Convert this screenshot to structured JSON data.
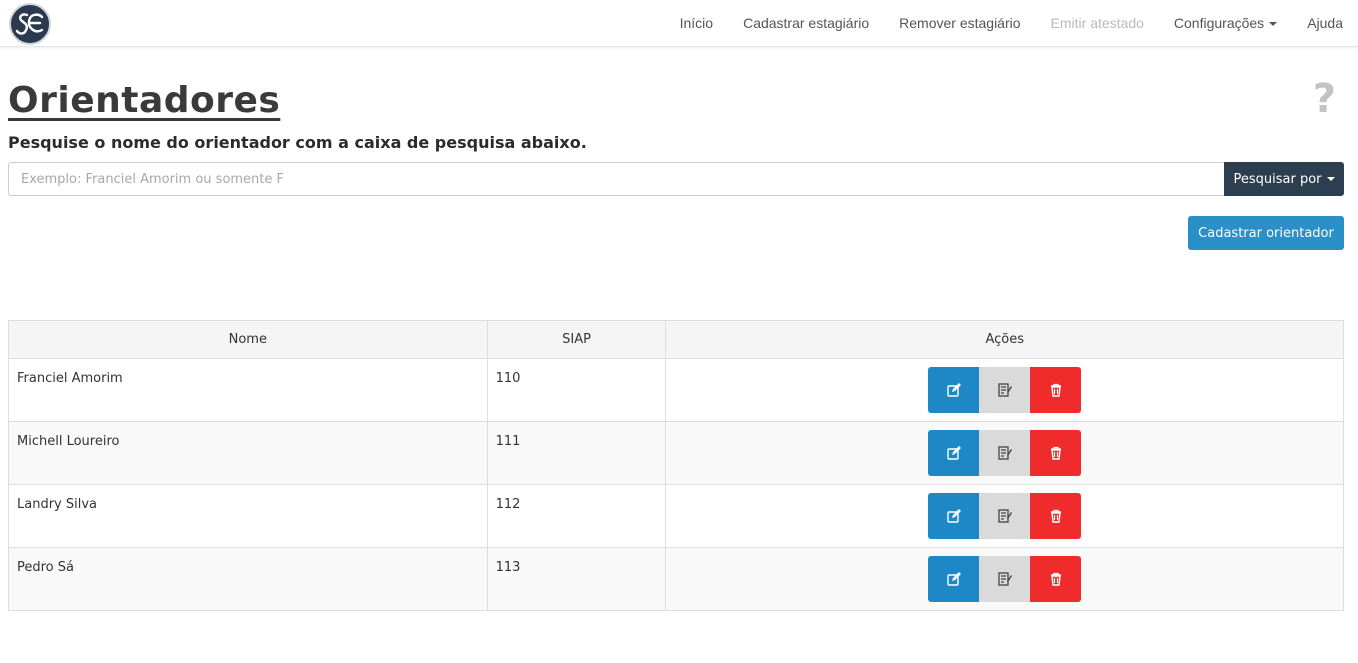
{
  "navbar": {
    "brand_logo": "SE",
    "items": [
      {
        "label": "Início",
        "disabled": false
      },
      {
        "label": "Cadastrar estagiário",
        "disabled": false
      },
      {
        "label": "Remover estagiário",
        "disabled": false
      },
      {
        "label": "Emitir atestado",
        "disabled": true
      },
      {
        "label": "Configurações",
        "disabled": false,
        "dropdown": true
      },
      {
        "label": "Ajuda",
        "disabled": false
      }
    ]
  },
  "header": {
    "title": "Orientadores",
    "help_icon": "?",
    "subtitle": "Pesquise o nome do orientador com a caixa de pesquisa abaixo."
  },
  "search": {
    "placeholder": "Exemplo: Franciel Amorim ou somente F",
    "value": "",
    "button_label": "Pesquisar por"
  },
  "add_button_label": "Cadastrar orientador",
  "table": {
    "headers": [
      "Nome",
      "SIAP",
      "Ações"
    ],
    "rows": [
      {
        "nome": "Franciel Amorim",
        "siap": "110"
      },
      {
        "nome": "Michell Loureiro",
        "siap": "111"
      },
      {
        "nome": "Landry Silva",
        "siap": "112"
      },
      {
        "nome": "Pedro Sá",
        "siap": "113"
      }
    ],
    "action_icons": [
      "edit-icon",
      "notes-icon",
      "trash-icon"
    ]
  },
  "colors": {
    "navbar_bg": "#ffffff",
    "search_button": "#2c3e50",
    "primary": "#2b90c8",
    "edit": "#1e88c7",
    "view": "#dadada",
    "delete": "#ef2b2b"
  }
}
